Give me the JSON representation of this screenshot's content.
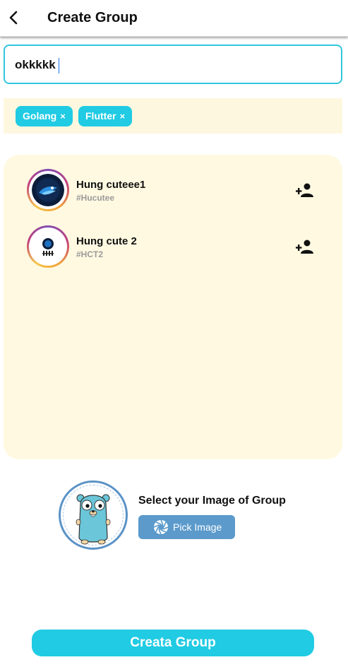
{
  "header": {
    "title": "Create Group",
    "back_icon": "chevron-left-icon"
  },
  "group_name_input": {
    "value": "okkkkk",
    "placeholder": ""
  },
  "tags": [
    {
      "label": "Golang",
      "remove_label": "×"
    },
    {
      "label": "Flutter",
      "remove_label": "×"
    }
  ],
  "members": [
    {
      "name": "Hung cuteee1",
      "handle": "#Hucutee",
      "action_icon": "person-add-icon"
    },
    {
      "name": "Hung cute 2",
      "handle": "#HCT2",
      "action_icon": "person-add-icon"
    }
  ],
  "image_section": {
    "label": "Select your Image of Group",
    "pick_button_label": "Pick Image",
    "pick_icon": "camera-aperture-icon",
    "preview_icon": "gopher-mascot-icon"
  },
  "create_button_label": "Creata Group",
  "colors": {
    "accent": "#20cbe3",
    "panel": "#fff9e1",
    "pick_button": "#5b9acb"
  }
}
